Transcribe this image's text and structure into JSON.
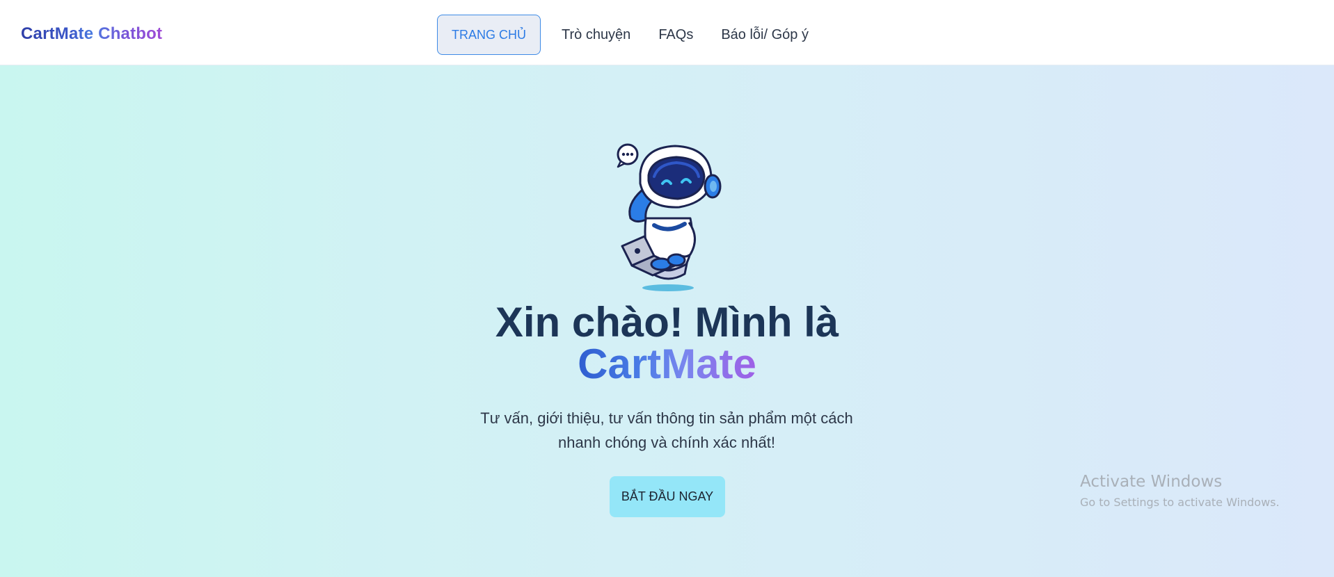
{
  "brand": {
    "name": "CartMate Chatbot"
  },
  "nav": {
    "items": [
      {
        "label": "TRANG CHỦ",
        "active": true
      },
      {
        "label": "Trò chuyện",
        "active": false
      },
      {
        "label": "FAQs",
        "active": false
      },
      {
        "label": "Báo lỗi/ Góp ý",
        "active": false
      }
    ]
  },
  "hero": {
    "heading_line1": "Xin chào! Mình là",
    "heading_brand": "CartMate",
    "subtitle": "Tư vấn, giới thiệu, tư vấn thông tin sản phẩm một cách nhanh chóng và chính xác nhất!",
    "cta_label": "BẮT ĐẦU NGAY",
    "illustration_icon": "robot-icon"
  },
  "watermark": {
    "title": "Activate Windows",
    "subtitle": "Go to Settings to activate Windows."
  },
  "colors": {
    "accent": "#2c7be5",
    "heading": "#1c3557",
    "cta_bg": "#94e6f8",
    "hero_gradient_start": "#c9f6f0",
    "hero_gradient_end": "#dbe8fa"
  }
}
